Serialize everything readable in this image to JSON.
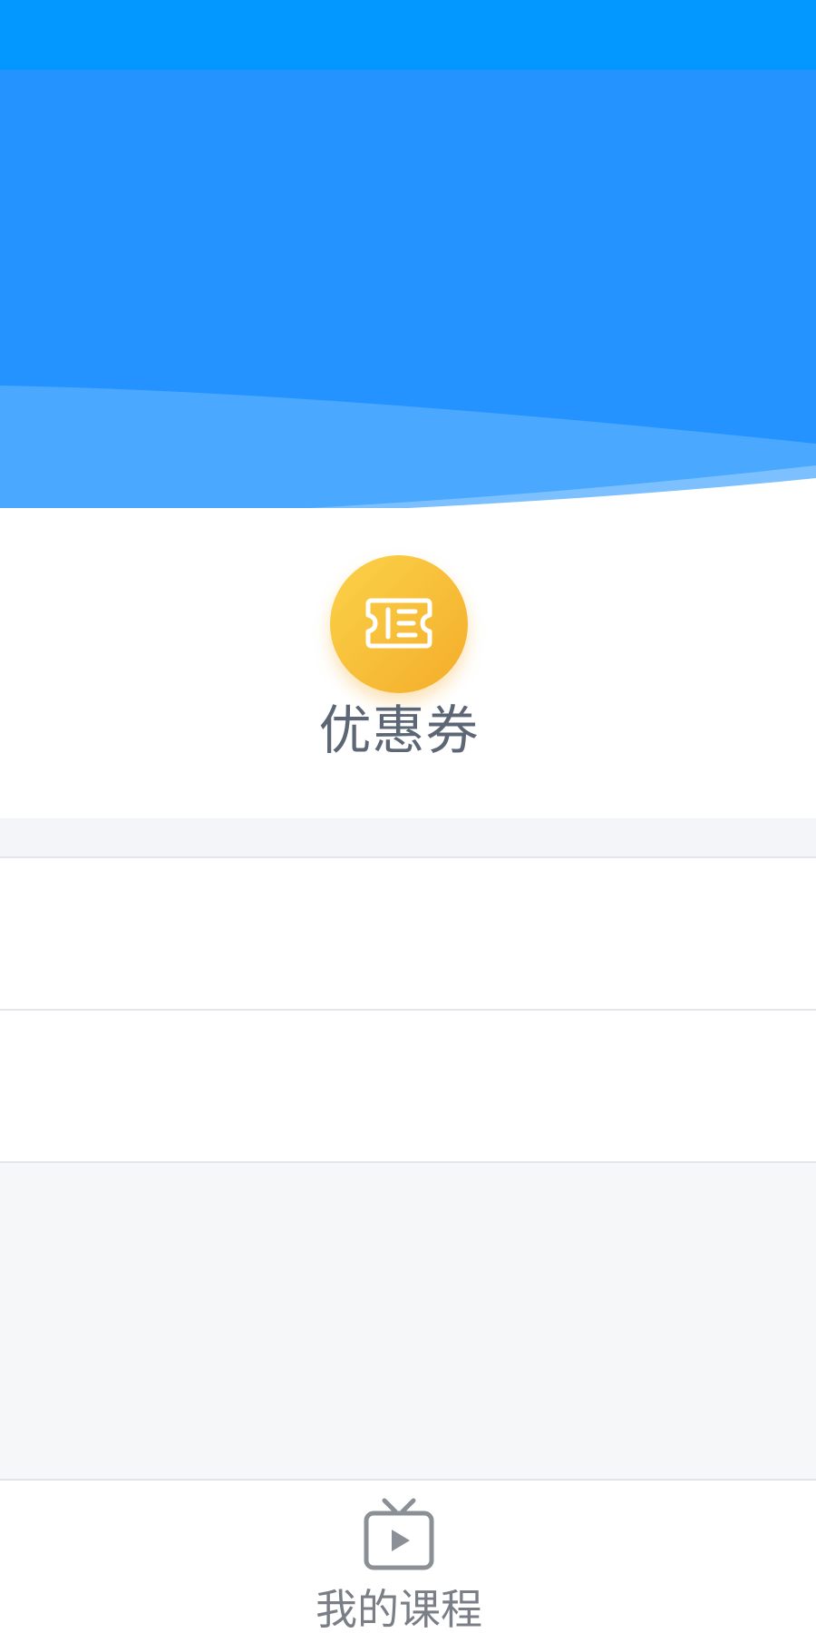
{
  "theme": {
    "status_bar_color": "#0398ff",
    "header_color": "#2492ff",
    "coupon_gradient": [
      "#fbd24a",
      "#f4ad2a"
    ],
    "tab_inactive_color": "#7a7f87"
  },
  "quick_actions": [
    {
      "label": "优惠券",
      "icon": "ticket-icon"
    }
  ],
  "tab_bar": {
    "items": [
      {
        "label": "我的课程",
        "icon": "tv-play-icon"
      }
    ]
  }
}
